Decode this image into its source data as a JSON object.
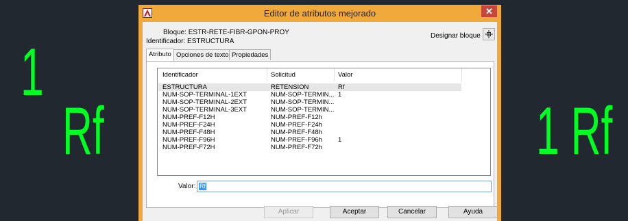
{
  "canvas": {
    "left_one": "1",
    "left_rf": "Rf",
    "right_text": "1 Rf",
    "text_color": "#00ff22",
    "background": "#212830"
  },
  "dialog": {
    "title": "Editor de atributos mejorado",
    "close_glyph": "✕",
    "block_line": "Bloque: ESTR-RETE-FIBR-GPON-PROY",
    "identifier_line": "Identificador: ESTRUCTURA",
    "select_block_label": "Designar bloque",
    "tabs": [
      "Atributo",
      "Opciones de texto",
      "Propiedades"
    ],
    "columns": [
      "Identificador",
      "Solicitud",
      "Valor"
    ],
    "rows": [
      {
        "id": "ESTRUCTURA",
        "prompt": "RETENSION",
        "value": "Rf"
      },
      {
        "id": "NUM-SOP-TERMINAL-1EXT",
        "prompt": "NUM-SOP-TERMIN...",
        "value": "1"
      },
      {
        "id": "NUM-SOP-TERMINAL-2EXT",
        "prompt": "NUM-SOP-TERMIN...",
        "value": ""
      },
      {
        "id": "NUM-SOP-TERMINAL-3EXT",
        "prompt": "NUM-SOP-TERMIN...",
        "value": ""
      },
      {
        "id": "NUM-PREF-F12H",
        "prompt": "NUM-PREF-F12h",
        "value": ""
      },
      {
        "id": "NUM-PREF-F24H",
        "prompt": "NUM-PREF-F24h",
        "value": ""
      },
      {
        "id": "NUM-PREF-F48H",
        "prompt": "NUM-PREF-F48h",
        "value": ""
      },
      {
        "id": "NUM-PREF-F96H",
        "prompt": "NUM-PREF-F96h",
        "value": "1"
      },
      {
        "id": "NUM-PREF-F72H",
        "prompt": "NUM-PREF-F72h",
        "value": ""
      }
    ],
    "valor_label": "Valor:",
    "valor_value": "Rf",
    "buttons": {
      "apply": "Aplicar",
      "ok": "Aceptar",
      "cancel": "Cancelar",
      "help": "Ayuda"
    }
  }
}
